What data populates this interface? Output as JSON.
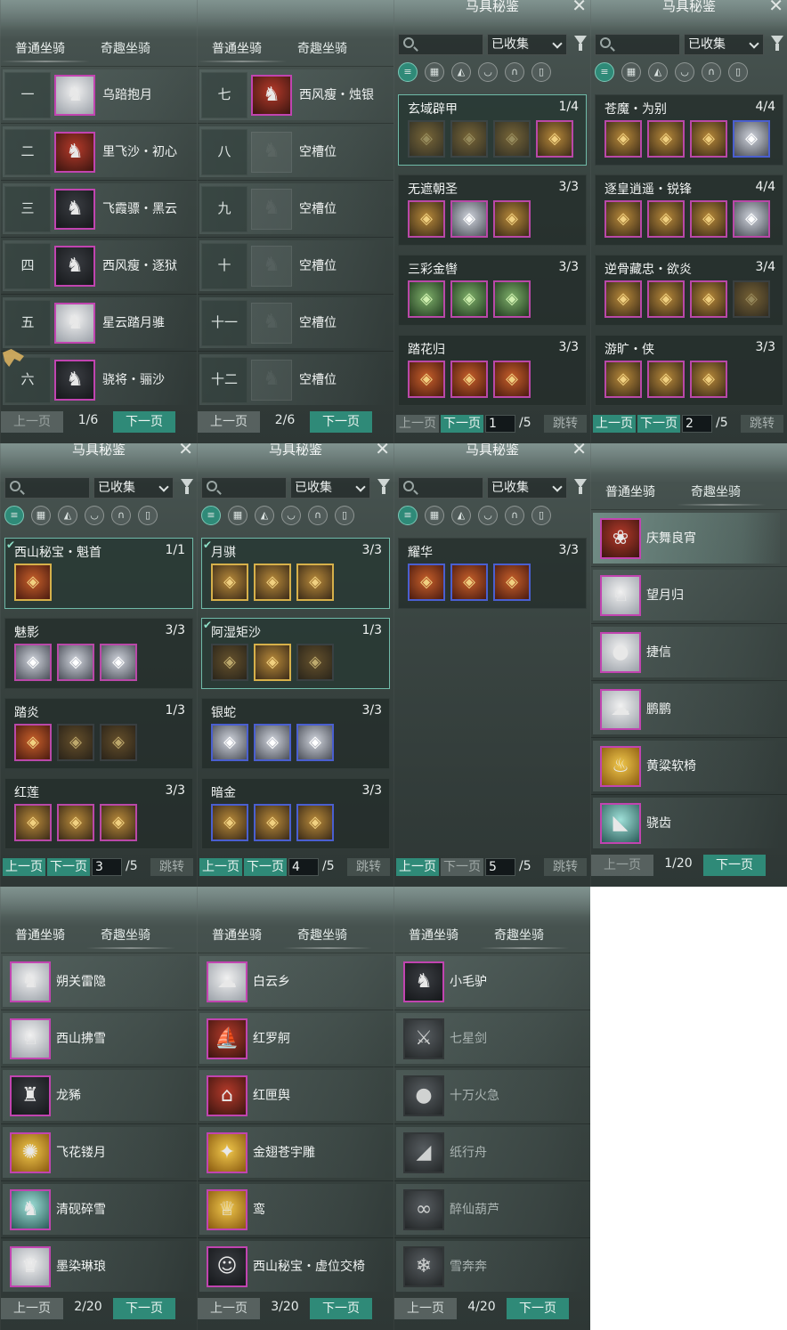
{
  "tabs": {
    "normal": "普通坐骑",
    "fun": "奇趣坐骑"
  },
  "pager": {
    "prev": "上一页",
    "next": "下一页",
    "jump": "跳转"
  },
  "codex": {
    "title": "马具秘鉴",
    "filter": "已收集",
    "search_placeholder": ""
  },
  "colors": {
    "accent": "#2f8a78",
    "frame_purple": "#b948a8",
    "frame_blue": "#4a5fd0",
    "frame_gold": "#d6b04a"
  },
  "normal_page1": {
    "page": "1/6",
    "rows": [
      {
        "num": "一",
        "name": "乌踣抱月",
        "icon": "white-horse-icon"
      },
      {
        "num": "二",
        "name": "里飞沙・初心",
        "icon": "red-white-horse-icon"
      },
      {
        "num": "三",
        "name": "飞霞骠・黑云",
        "icon": "black-horse-icon"
      },
      {
        "num": "四",
        "name": "西风瘦・逐狱",
        "icon": "black-horse-icon"
      },
      {
        "num": "五",
        "name": "星云踏月骓",
        "icon": "white-horse-icon"
      },
      {
        "num": "六",
        "name": "骁将・骊沙",
        "icon": "black-horse-icon"
      }
    ]
  },
  "normal_page2": {
    "page": "2/6",
    "rows": [
      {
        "num": "七",
        "name": "西风瘦・烛银",
        "icon": "red-horse-icon"
      },
      {
        "num": "八",
        "name": "空槽位"
      },
      {
        "num": "九",
        "name": "空槽位"
      },
      {
        "num": "十",
        "name": "空槽位"
      },
      {
        "num": "十一",
        "name": "空槽位"
      },
      {
        "num": "十二",
        "name": "空槽位"
      }
    ]
  },
  "codex_p1": {
    "page": "1",
    "total": "/5",
    "sets": [
      {
        "name": "玄域辟甲",
        "count": "1/4"
      },
      {
        "name": "无遮朝圣",
        "count": "3/3"
      },
      {
        "name": "三彩金辔",
        "count": "3/3"
      },
      {
        "name": "踏花归",
        "count": "3/3"
      }
    ]
  },
  "codex_p2": {
    "page": "2",
    "total": "/5",
    "sets": [
      {
        "name": "苍魔・为别",
        "count": "4/4"
      },
      {
        "name": "逐皇逍遥・锐锋",
        "count": "4/4"
      },
      {
        "name": "逆骨藏忠・欲炎",
        "count": "3/4"
      },
      {
        "name": "游旷・侠",
        "count": "3/3"
      }
    ]
  },
  "codex_p3": {
    "page": "3",
    "total": "/5",
    "sets": [
      {
        "name": "西山秘宝・魁首",
        "count": "1/1"
      },
      {
        "name": "魅影",
        "count": "3/3"
      },
      {
        "name": "踏炎",
        "count": "1/3"
      },
      {
        "name": "红莲",
        "count": "3/3"
      }
    ]
  },
  "codex_p4": {
    "page": "4",
    "total": "/5",
    "sets": [
      {
        "name": "月骐",
        "count": "3/3"
      },
      {
        "name": "阿湿矩沙",
        "count": "1/3"
      },
      {
        "name": "银蛇",
        "count": "3/3"
      },
      {
        "name": "暗金",
        "count": "3/3"
      }
    ]
  },
  "codex_p5": {
    "page": "5",
    "total": "/5",
    "sets": [
      {
        "name": "耀华",
        "count": "3/3"
      }
    ]
  },
  "fun_page1": {
    "page": "1/20",
    "rows": [
      {
        "name": "庆舞良宵",
        "icon": "lion-dance-icon"
      },
      {
        "name": "望月归",
        "icon": "deer-icon"
      },
      {
        "name": "捷信",
        "icon": "elephant-icon"
      },
      {
        "name": "鹏鹏",
        "icon": "sheep-icon"
      },
      {
        "name": "黄粱软椅",
        "icon": "chair-icon"
      },
      {
        "name": "骁齿",
        "icon": "shark-icon"
      }
    ]
  },
  "fun_page2": {
    "page": "2/20",
    "rows": [
      {
        "name": "朔关雷隐",
        "icon": "white-horse-icon"
      },
      {
        "name": "西山拂雪",
        "icon": "white-deer-icon"
      },
      {
        "name": "龙豨",
        "icon": "dragon-boar-icon"
      },
      {
        "name": "飞花镂月",
        "icon": "gold-orb-icon"
      },
      {
        "name": "清砚碎雪",
        "icon": "jade-horse-icon"
      },
      {
        "name": "墨染琳琅",
        "icon": "ink-beast-icon"
      }
    ]
  },
  "fun_page3": {
    "page": "3/20",
    "rows": [
      {
        "name": "白云乡",
        "icon": "cloud-icon"
      },
      {
        "name": "红罗舸",
        "icon": "boat-icon"
      },
      {
        "name": "红匣舆",
        "icon": "sedan-icon"
      },
      {
        "name": "金翅苍宇雕",
        "icon": "eagle-icon"
      },
      {
        "name": "鸾",
        "icon": "phoenix-icon"
      },
      {
        "name": "西山秘宝・虚位交椅",
        "icon": "character-icon"
      }
    ]
  },
  "fun_page4": {
    "page": "4/20",
    "rows": [
      {
        "name": "小毛驴",
        "icon": "donkey-icon"
      },
      {
        "name": "七星剑",
        "icon": "sword-icon"
      },
      {
        "name": "十万火急",
        "icon": "bomb-icon"
      },
      {
        "name": "纸行舟",
        "icon": "paper-boat-icon"
      },
      {
        "name": "醉仙葫芦",
        "icon": "gourd-icon"
      },
      {
        "name": "雪奔奔",
        "icon": "snow-beast-icon"
      }
    ]
  }
}
